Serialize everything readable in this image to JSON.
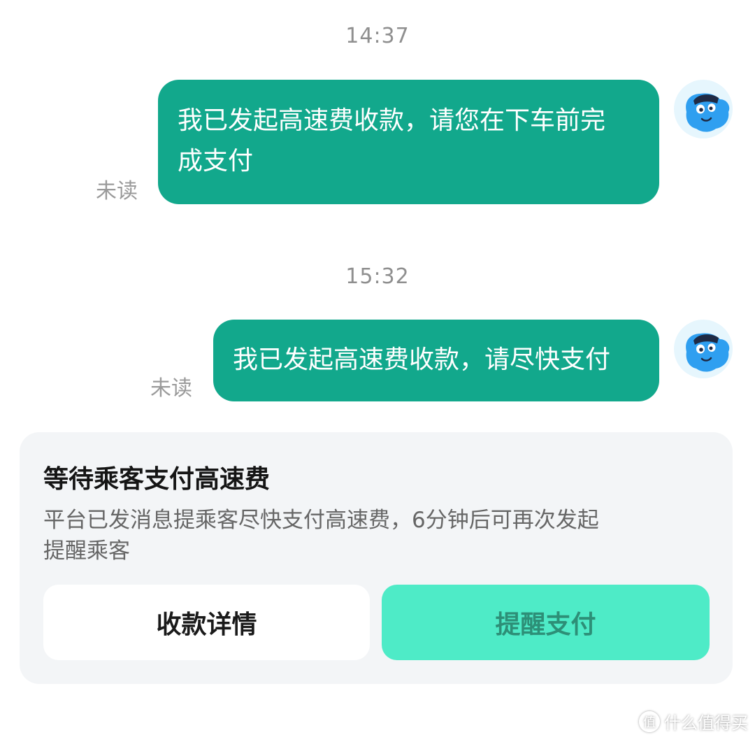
{
  "chat": {
    "messages": [
      {
        "time": "14:37",
        "line1": "我已发起高速费收款，请您在下车前完",
        "line2": "成支付",
        "status": "未读"
      },
      {
        "time": "15:32",
        "line1": "我已发起高速费收款，请尽快支付",
        "status": "未读"
      }
    ]
  },
  "card": {
    "title": "等待乘客支付高速费",
    "desc_line1": "平台已发消息提乘客尽快支付高速费，6分钟后可再次发起",
    "desc_line2": "提醒乘客",
    "detail_button": "收款详情",
    "remind_button": "提醒支付"
  },
  "watermark": {
    "badge": "值",
    "text": "什么值得买"
  },
  "colors": {
    "bubble": "#12a88c",
    "remind_button": "#4eebc7",
    "remind_text": "#2d8f77",
    "card_bg": "#f3f5f7"
  },
  "icons": {
    "avatar": "driver-avatar-icon"
  }
}
